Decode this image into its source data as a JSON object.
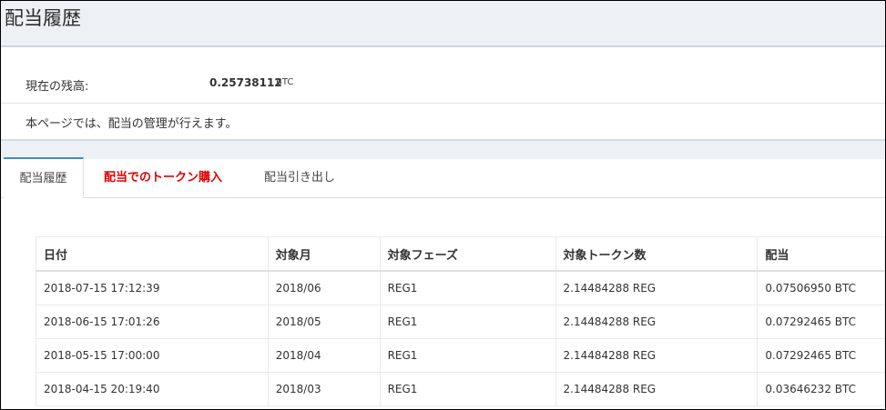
{
  "header": {
    "title": "配当履歴"
  },
  "balance": {
    "label": "現在の残高:",
    "value": "0.25738112",
    "unit": "BTC"
  },
  "description": "本ページでは、配当の管理が行えます。",
  "tabs": [
    {
      "label": "配当履歴",
      "active": true
    },
    {
      "label": "配当でのトークン購入",
      "active": false,
      "color": "#e00000"
    },
    {
      "label": "配当引き出し",
      "active": false
    }
  ],
  "table": {
    "columns": [
      "日付",
      "対象月",
      "対象フェーズ",
      "対象トークン数",
      "配当"
    ],
    "rows": [
      {
        "date": "2018-07-15 17:12:39",
        "month": "2018/06",
        "phase": "REG1",
        "tokens": "2.14484288 REG",
        "dividend": "0.07506950 BTC"
      },
      {
        "date": "2018-06-15 17:01:26",
        "month": "2018/05",
        "phase": "REG1",
        "tokens": "2.14484288 REG",
        "dividend": "0.07292465 BTC"
      },
      {
        "date": "2018-05-15 17:00:00",
        "month": "2018/04",
        "phase": "REG1",
        "tokens": "2.14484288 REG",
        "dividend": "0.07292465 BTC"
      },
      {
        "date": "2018-04-15 20:19:40",
        "month": "2018/03",
        "phase": "REG1",
        "tokens": "2.14484288 REG",
        "dividend": "0.03646232 BTC"
      }
    ]
  },
  "colors": {
    "accent": "#3c8dbc",
    "highlight_tab": "#e00000",
    "header_bg": "#edf0f4"
  }
}
